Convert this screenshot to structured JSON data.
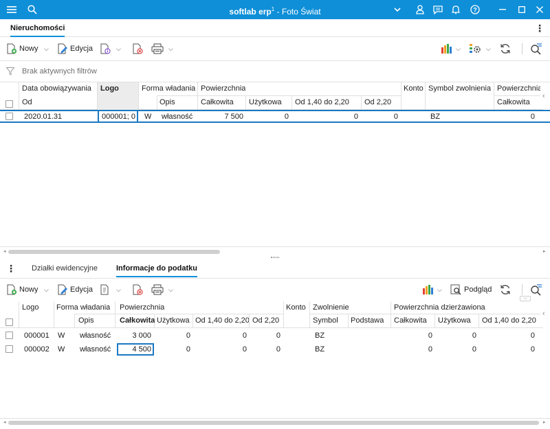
{
  "window": {
    "title_bold": "softlab erp",
    "title_sup": "1",
    "title_rest": " - Foto Świat"
  },
  "top_tab": {
    "label": "Nieruchomości"
  },
  "toolbar1": {
    "new_label": "Nowy",
    "edit_label": "Edycja"
  },
  "filter": {
    "text": "Brak aktywnych filtrów"
  },
  "grid1": {
    "h_data_obow": "Data obowiązywania",
    "h_od": "Od",
    "h_logo": "Logo",
    "h_forma": "Forma władania",
    "h_opis": "Opis",
    "h_powierzchnia": "Powierzchnia",
    "h_calkowita": "Całkowita",
    "h_uzytkowa": "Użytkowa",
    "h_od140": "Od 1,40 do 2,20",
    "h_od220": "Od 2,20",
    "h_konto": "Konto",
    "h_symbol": "Symbol zwolnienia",
    "h_pow2": "Powierzchnia",
    "h_calkowita2": "Całkowita",
    "rows": [
      {
        "date": "2020.01.31",
        "logo": "000001; 0",
        "forma": "W",
        "opis": "własność",
        "calk": "7 500",
        "uzyt": "0",
        "od140": "0",
        "od220": "0",
        "symbol": "BZ",
        "calk2": "0"
      }
    ]
  },
  "bottom_tabs": {
    "tab1": "Działki ewidencyjne",
    "tab2": "Informacje do podatku"
  },
  "toolbar2": {
    "new_label": "Nowy",
    "edit_label": "Edycja",
    "preview_label": "Podgląd"
  },
  "grid2": {
    "h_logo": "Logo",
    "h_forma": "Forma władania",
    "h_opis": "Opis",
    "h_powierzchnia": "Powierzchnia",
    "h_calkowita": "Całkowita",
    "h_uzytkowa": "Użytkowa",
    "h_od140": "Od 1,40 do 2,20",
    "h_od220": "Od 2,20",
    "h_konto": "Konto",
    "h_zwolnienie": "Zwolnienie",
    "h_symbol": "Symbol",
    "h_podstawa": "Podstawa",
    "h_pow_dzierz": "Powierzchnia dzierżawiona",
    "h_calkowita2": "Całkowita",
    "h_uzytkowa2": "Użytkowa",
    "h_od140_2": "Od 1,40 do 2,20",
    "rows": [
      {
        "logo": "000001",
        "forma": "W",
        "opis": "własność",
        "calk": "3 000",
        "uzyt": "0",
        "od140": "0",
        "od220": "0",
        "symbol": "BZ",
        "calk2": "0",
        "uzyt2": "0",
        "od140_2": "0"
      },
      {
        "logo": "000002",
        "forma": "W",
        "opis": "własność",
        "calk": "4 500",
        "uzyt": "0",
        "od140": "0",
        "od220": "0",
        "symbol": "BZ",
        "calk2": "0",
        "uzyt2": "0",
        "od140_2": "0"
      }
    ]
  },
  "colors": {
    "accent": "#0f8fd8"
  }
}
